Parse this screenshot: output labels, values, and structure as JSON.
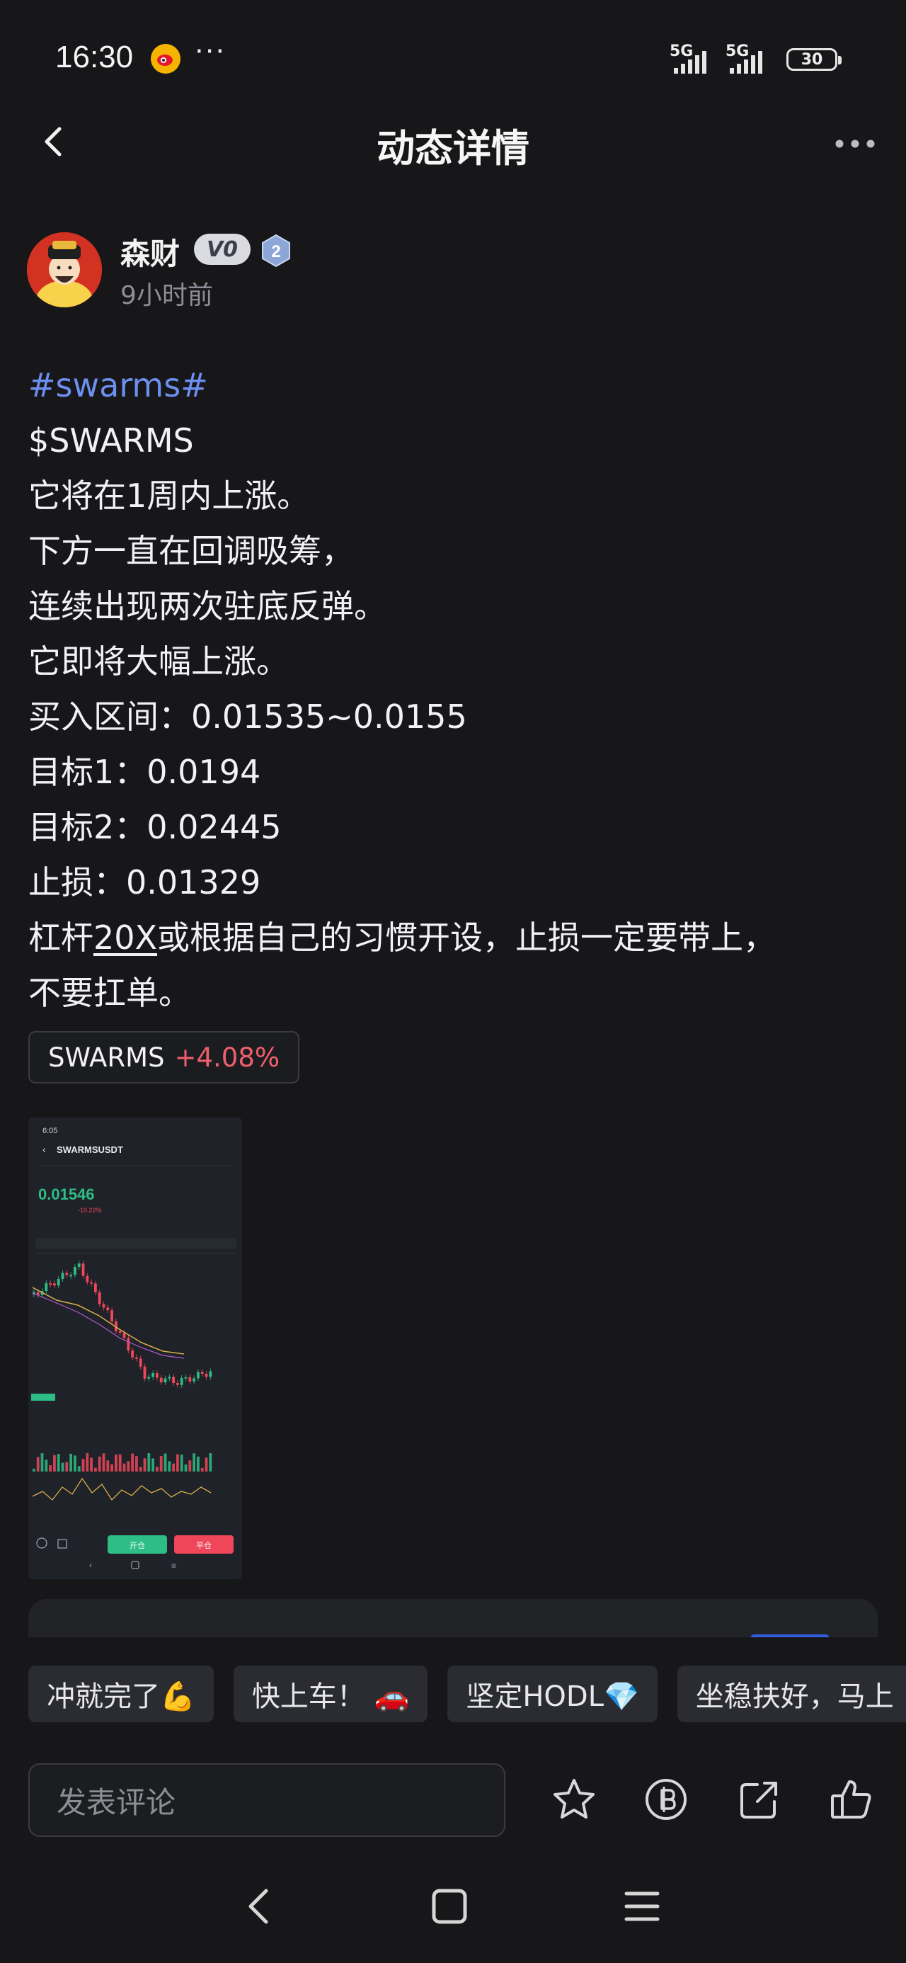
{
  "status_bar": {
    "time": "16:30",
    "more": "···",
    "net1": "5G",
    "net2": "5G",
    "battery": "30"
  },
  "header": {
    "title": "动态详情"
  },
  "author": {
    "name": "森财",
    "badge": "V0",
    "level": "2",
    "time_ago": "9小时前"
  },
  "post": {
    "hashtag": "#swarms#",
    "lines": [
      "$SWARMS",
      "它将在1周内上涨。",
      "下方一直在回调吸筹，",
      "连续出现两次驻底反弹。",
      "它即将大幅上涨。",
      "买入区间：0.01535~0.0155",
      "目标1：0.0194",
      "目标2：0.02445",
      "止损：0.01329"
    ],
    "leverage_pre": "杠杆",
    "leverage_link": "20X",
    "leverage_post": "或根据自己的习惯开设，止损一定要带上，",
    "last_line": "不要扛单。"
  },
  "ticker": {
    "symbol": "SWARMS",
    "change": "+4.08%"
  },
  "thumbnail": {
    "time": "6:05",
    "pair": "SWARMSUSDT",
    "price": "0.01546",
    "change": "-10.22%",
    "open_btn": "开仓",
    "close_btn": "平仓"
  },
  "quick_replies": [
    "冲就完了💪",
    "快上车！ 🚗",
    "坚定HODL💎",
    "坐稳扶好，马上"
  ],
  "comment_box": {
    "placeholder": "发表评论"
  },
  "colors": {
    "background": "#17171a",
    "hashtag": "#6c8ff0",
    "positive_change": "#ef5f6b",
    "candle_up": "#2ebd85",
    "candle_down": "#f0465a"
  }
}
